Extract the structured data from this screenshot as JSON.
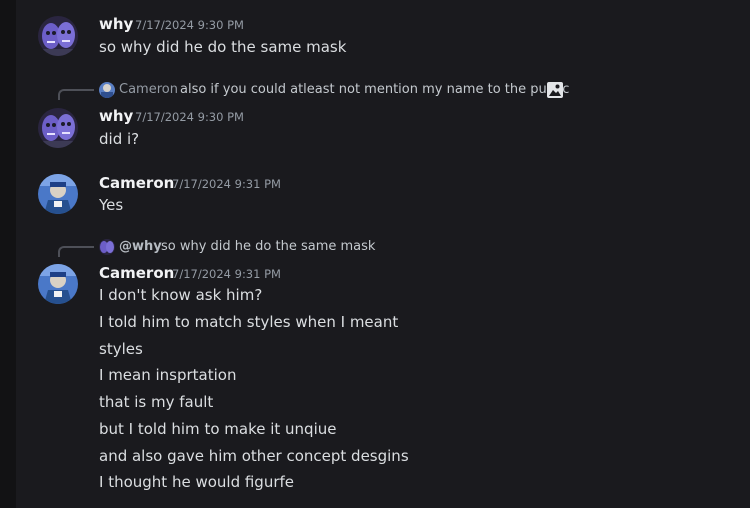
{
  "messages": [
    {
      "author": "why",
      "timestamp": "7/17/2024 9:30 PM",
      "lines": [
        "so why did he do the same mask"
      ]
    },
    {
      "reply": {
        "author": "Cameron",
        "text": "also if you could atleast not mention my name to the public",
        "attachment_icon": "image-icon"
      },
      "author": "why",
      "timestamp": "7/17/2024 9:30 PM",
      "lines": [
        "did i?"
      ]
    },
    {
      "author": "Cameron",
      "timestamp": "7/17/2024 9:31 PM",
      "lines": [
        "Yes"
      ]
    },
    {
      "reply": {
        "author": "@why",
        "text": "so why did he do the same mask"
      },
      "author": "Cameron",
      "timestamp": "7/17/2024 9:31 PM",
      "lines": [
        "I don't know ask him?",
        "I told him to match styles when I meant",
        "styles",
        "I mean insprtation",
        "that is my fault",
        "but I told him to make it unqiue",
        "and also gave him other concept desgins",
        "I thought he would figurfe"
      ]
    }
  ],
  "colors": {
    "background": "#1a1a1e",
    "username": "#f2f3f5",
    "timestamp": "#949ba4",
    "message_text": "#dbdee1",
    "reply_spine": "#4e5058"
  }
}
